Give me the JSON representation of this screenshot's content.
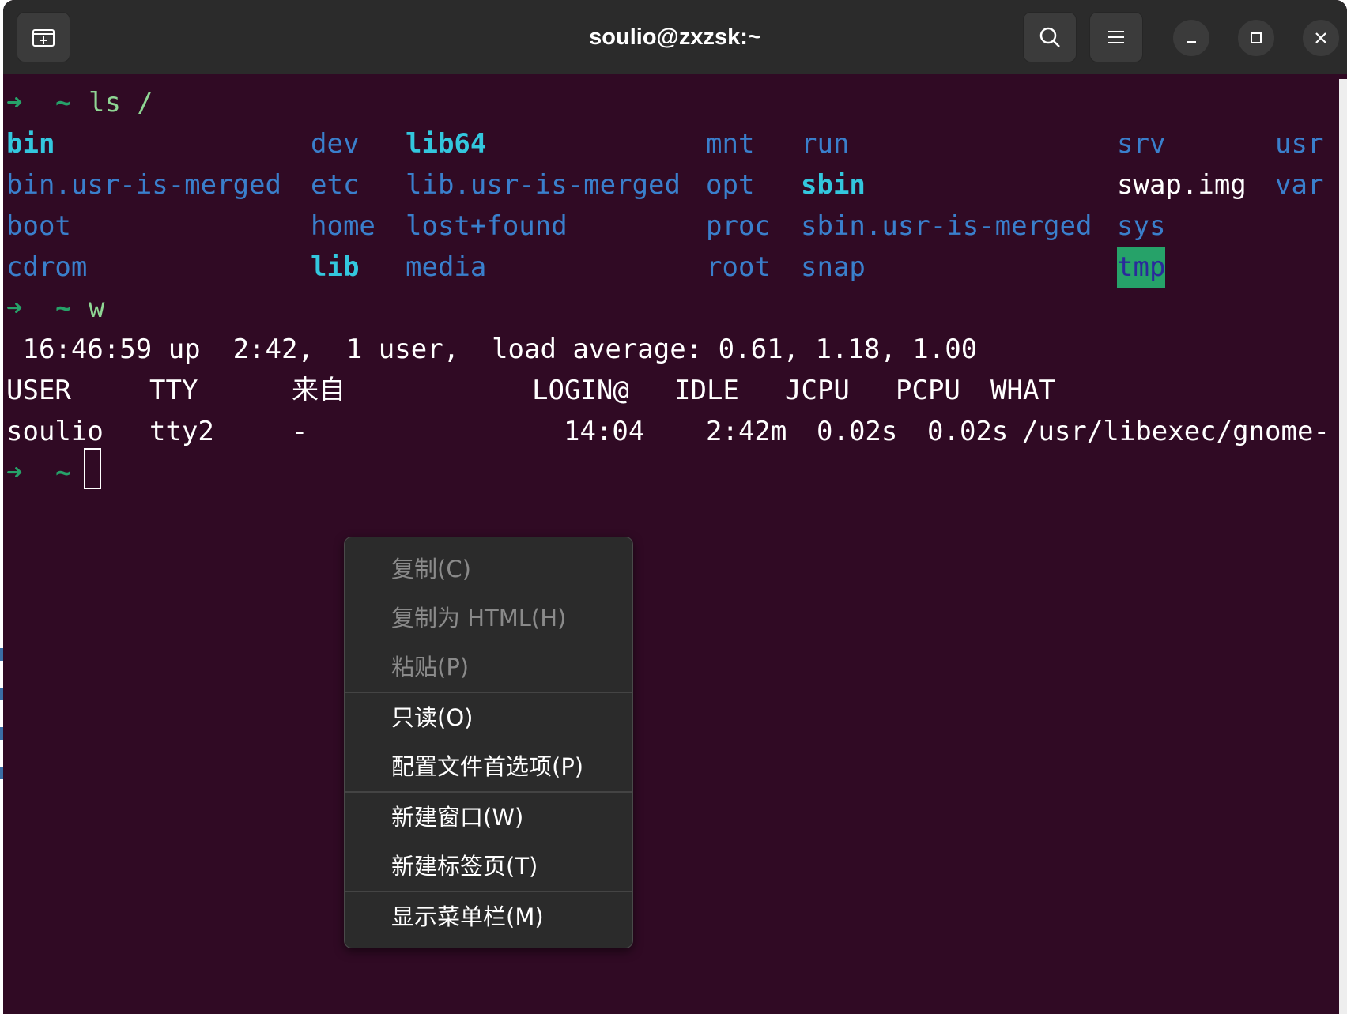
{
  "window": {
    "title": "soulio@zxzsk:~"
  },
  "titlebar": {
    "new_tab_icon": "new-tab-icon",
    "search_icon": "search-icon",
    "menu_icon": "hamburger-menu-icon",
    "minimize_icon": "minimize-icon",
    "maximize_icon": "maximize-icon",
    "close_icon": "close-icon"
  },
  "terminal": {
    "prompt_arrow": "➜",
    "prompt_home": "~",
    "cmd1": "ls /",
    "ls": {
      "row1": [
        "bin",
        "dev",
        "lib64",
        "mnt",
        "run",
        "srv",
        "usr"
      ],
      "row2": [
        "bin.usr-is-merged",
        "etc",
        "lib.usr-is-merged",
        "opt",
        "sbin",
        "swap.img",
        "var"
      ],
      "row3": [
        "boot",
        "home",
        "lost+found",
        "proc",
        "sbin.usr-is-merged",
        "sys"
      ],
      "row4": [
        "cdrom",
        "lib",
        "media",
        "root",
        "snap",
        "tmp"
      ]
    },
    "cmd2": "w",
    "uptime_line": " 16:46:59 up  2:42,  1 user,  load average: 0.61, 1.18, 1.00",
    "w_header": {
      "user": "USER",
      "tty": "TTY",
      "from": "来自",
      "login": "LOGIN@",
      "idle": "IDLE",
      "jcpu": "JCPU",
      "pcpu": "PCPU",
      "what": "WHAT"
    },
    "w_row": {
      "user": "soulio",
      "tty": "tty2",
      "from": "-",
      "login": "14:04",
      "idle": "2:42m",
      "jcpu": "0.02s",
      "pcpu": "0.02s",
      "what": "/usr/libexec/gnome-"
    }
  },
  "context_menu": {
    "items": [
      {
        "label": "复制(C)",
        "enabled": false
      },
      {
        "label": "复制为 HTML(H)",
        "enabled": false
      },
      {
        "label": "粘贴(P)",
        "enabled": false
      },
      {
        "label": "只读(O)",
        "enabled": true
      },
      {
        "label": "配置文件首选项(P)",
        "enabled": true
      },
      {
        "label": "新建窗口(W)",
        "enabled": true
      },
      {
        "label": "新建标签页(T)",
        "enabled": true
      },
      {
        "label": "显示菜单栏(M)",
        "enabled": true
      }
    ]
  },
  "colors": {
    "terminal_bg": "#300a24",
    "titlebar_bg": "#2b2b2b",
    "prompt_green": "#26a269",
    "dir_blue": "#3584e4",
    "tmp_highlight": "#26a269"
  }
}
